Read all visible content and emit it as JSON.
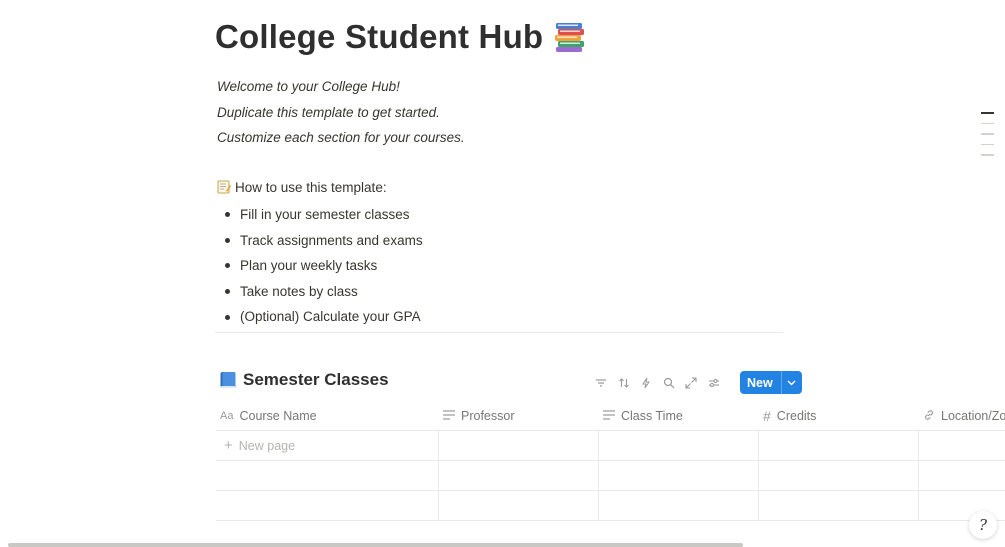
{
  "page": {
    "title": "College Student Hub",
    "title_icon": "books-emoji-icon"
  },
  "intro": [
    "Welcome to your College Hub!",
    "Duplicate this template to get started.",
    "Customize each section for your courses."
  ],
  "howto": {
    "icon": "memo-emoji-icon",
    "heading": "How to use this template:",
    "items": [
      "Fill in your semester classes",
      "Track assignments and exams",
      "Plan your weekly tasks",
      "Take notes by class",
      "(Optional) Calculate your GPA"
    ]
  },
  "database": {
    "icon": "blue-book-emoji-icon",
    "title": "Semester Classes",
    "toolbar": [
      "filter-icon",
      "sort-icon",
      "lightning-icon",
      "search-icon",
      "expand-icon",
      "settings-icon"
    ],
    "new_label": "New",
    "accent_color": "#2383e2",
    "columns": [
      {
        "label": "Course Name",
        "icon": "text-aa-icon"
      },
      {
        "label": "Professor",
        "icon": "lines-icon"
      },
      {
        "label": "Class Time",
        "icon": "lines-icon"
      },
      {
        "label": "Credits",
        "icon": "hash-icon"
      },
      {
        "label": "Location/Zo",
        "icon": "link-icon"
      }
    ],
    "new_page_label": "New page"
  },
  "help_button": {
    "label": "?"
  }
}
